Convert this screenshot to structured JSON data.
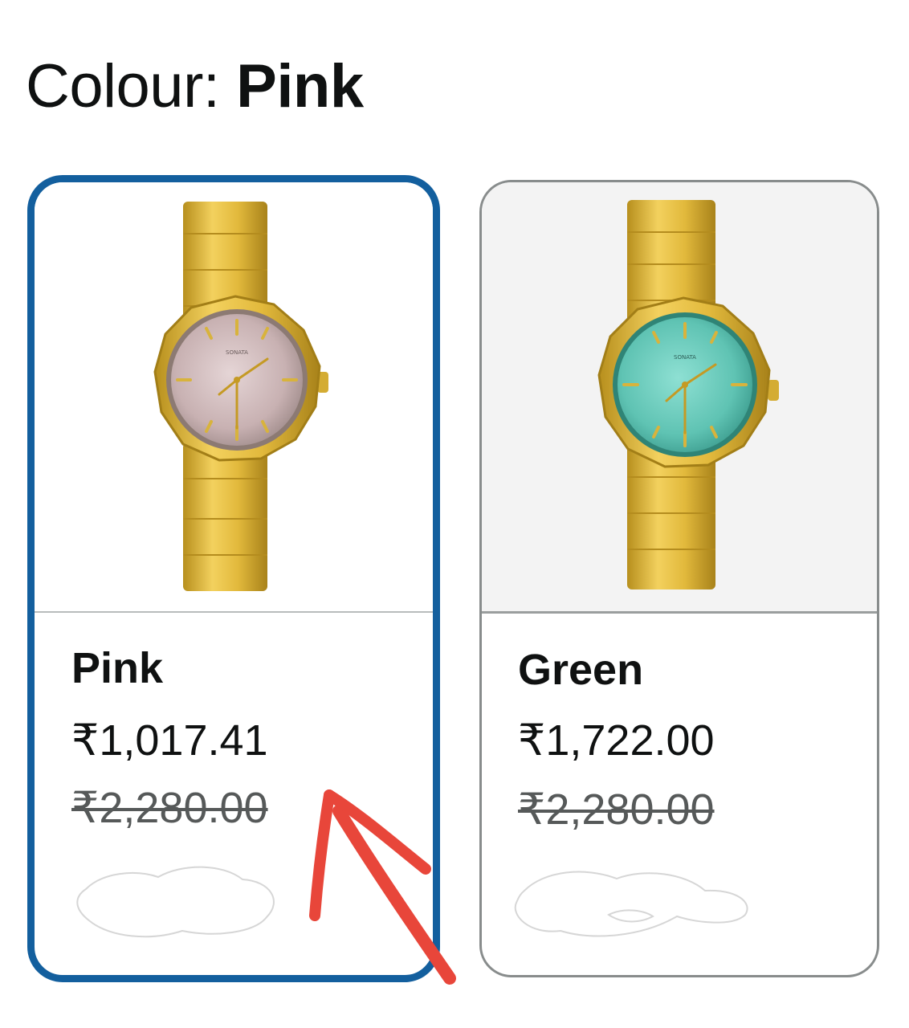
{
  "heading": {
    "label": "Colour: ",
    "value": "Pink"
  },
  "swatches": [
    {
      "name": "Pink",
      "price": "₹1,017.41",
      "mrp": "₹2,280.00",
      "selected": true,
      "dial_color": "#cdb6b6",
      "icon": "watch-image"
    },
    {
      "name": "Green",
      "price": "₹1,722.00",
      "mrp": "₹2,280.00",
      "selected": false,
      "dial_color": "#5fc3b3",
      "icon": "watch-image"
    }
  ],
  "colors": {
    "selected_border": "#135f9e",
    "unselected_border": "#888c8c",
    "strikethrough_text": "#565959",
    "annotation_arrow": "#e8463a",
    "gold": "#d8b135"
  }
}
